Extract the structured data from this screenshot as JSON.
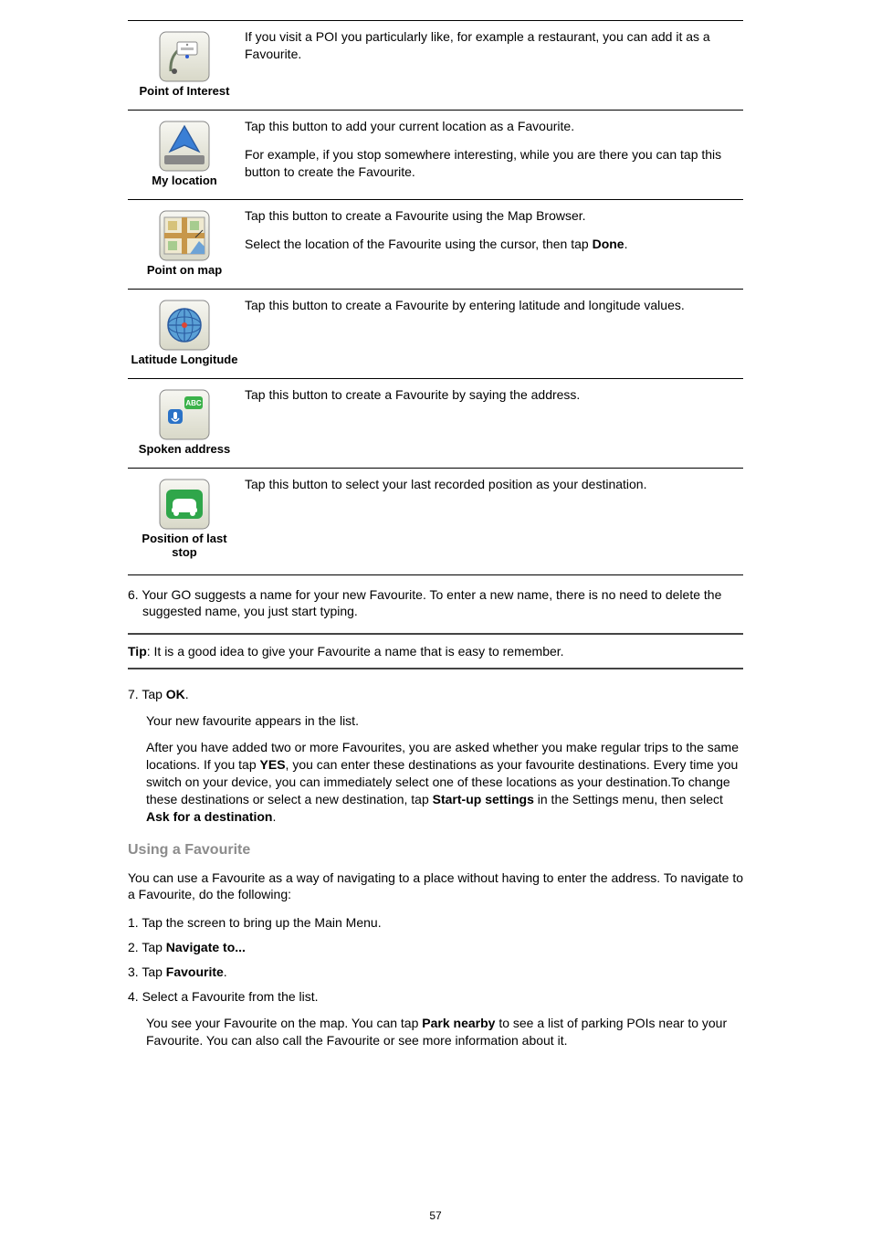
{
  "rows": {
    "poi": {
      "label": "Point of Interest",
      "p1": "If you visit a POI you particularly like, for example a restaurant, you can add it as a Favourite."
    },
    "myloc": {
      "label": "My location",
      "p1": "Tap this button to add your current location as a Favourite.",
      "p2": "For example, if you stop somewhere interesting, while you are there you can tap this button to create the Favourite."
    },
    "pointmap": {
      "label": "Point on map",
      "p1": "Tap this button to create a Favourite using the Map Browser.",
      "p2_pre": "Select the location of the Favourite using the cursor, then tap ",
      "p2_b": "Done",
      "p2_post": "."
    },
    "latlon": {
      "label": "Latitude Longitude",
      "p1": "Tap this button to create a Favourite by entering latitude and longitude values."
    },
    "spoken": {
      "label": "Spoken address",
      "p1": "Tap this button to create a Favourite by saying the address."
    },
    "poslast": {
      "label": "Position of last stop",
      "p1": "Tap this button to select your last recorded position as your destination."
    }
  },
  "step6": "6. Your GO suggests a name for your new Favourite. To enter a new name, there is no need to delete the suggested name, you just start typing.",
  "tip_b": "Tip",
  "tip_rest": ": It is a good idea to give your Favourite a name that is easy to remember.",
  "step7_pre": "7. Tap ",
  "step7_b": "OK",
  "step7_post": ".",
  "step7_body1": "Your new favourite appears in the list.",
  "step7_body2_pre": "After you have added two or more Favourites, you are asked whether you make regular trips to the same locations. If you tap ",
  "step7_body2_b1": "YES",
  "step7_body2_mid1": ", you can enter these destinations as your favourite destinations. Every time you switch on your device, you can immediately select one of these locations as your destination.To change these destinations or select a new destination, tap ",
  "step7_body2_b2": "Start-up settings",
  "step7_body2_mid2": " in the Settings menu, then select ",
  "step7_body2_b3": "Ask for a destination",
  "step7_body2_post": ".",
  "section_h": "Using a Favourite",
  "section_p": "You can use a Favourite as a way of navigating to a place without having to enter the address. To navigate to a Favourite, do the following:",
  "s1": "1. Tap the screen to bring up the Main Menu.",
  "s2_pre": "2. Tap ",
  "s2_b": "Navigate to...",
  "s3_pre": "3. Tap ",
  "s3_b": "Favourite",
  "s3_post": ".",
  "s4": "4. Select a Favourite from the list.",
  "s4_body_pre": "You see your Favourite on the map. You can tap ",
  "s4_body_b": "Park nearby",
  "s4_body_post": " to see a list of parking POIs near to your Favourite. You can also call the Favourite or see more information about it.",
  "page_num": "57"
}
